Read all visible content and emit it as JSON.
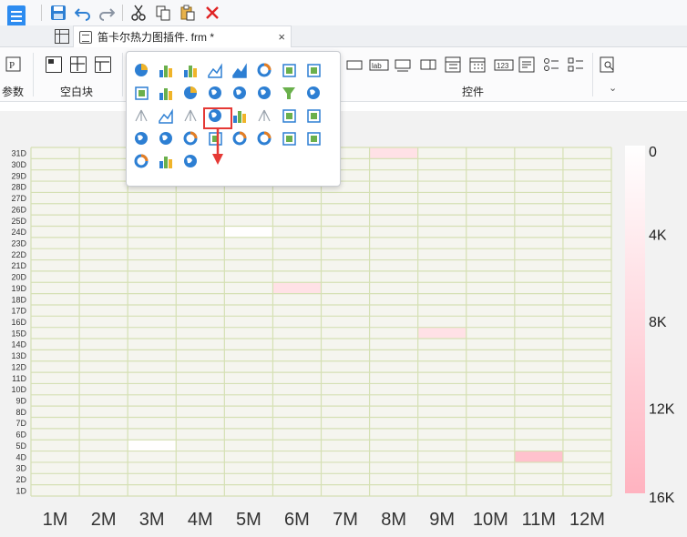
{
  "toolbar": {
    "save_icon": "save-icon",
    "undo_icon": "undo-icon",
    "redo_icon": "redo-icon",
    "cut_icon": "cut-icon",
    "copy_icon": "copy-icon",
    "paste_icon": "paste-icon",
    "delete_icon": "delete-icon"
  },
  "tab": {
    "title": "笛卡尔热力图插件. frm *",
    "close": "×"
  },
  "ribbon": {
    "param_label": "参数",
    "blank_block_label": "空白块",
    "controls_label": "控件",
    "expand_icon": "chevron-down-icon"
  },
  "heatmap": {
    "colors": {
      "grid_line": "#d5e0b4",
      "cell_fill": "#f5f5ef",
      "scale_top": "#ffffff",
      "scale_bottom": "#ffb3c0",
      "cell_highlight": "#ffd4dc"
    },
    "legend_ticks": [
      "0",
      "4K",
      "8K",
      "12K",
      "16K"
    ]
  },
  "chart_data": {
    "type": "heatmap",
    "x_categories": [
      "1M",
      "2M",
      "3M",
      "4M",
      "5M",
      "6M",
      "7M",
      "8M",
      "9M",
      "10M",
      "11M",
      "12M"
    ],
    "y_categories": [
      "1D",
      "2D",
      "3D",
      "4D",
      "5D",
      "6D",
      "7D",
      "8D",
      "9D",
      "10D",
      "11D",
      "12D",
      "13D",
      "14D",
      "15D",
      "16D",
      "17D",
      "18D",
      "19D",
      "20D",
      "21D",
      "22D",
      "23D",
      "24D",
      "25D",
      "26D",
      "27D",
      "28D",
      "29D",
      "30D",
      "31D"
    ],
    "legend_range": [
      0,
      16000
    ],
    "points": [
      {
        "x": "8M",
        "y": "31D",
        "value": 4000
      },
      {
        "x": "5M",
        "y": "24D",
        "value": 100
      },
      {
        "x": "6M",
        "y": "19D",
        "value": 4000
      },
      {
        "x": "9M",
        "y": "15D",
        "value": 4000
      },
      {
        "x": "3M",
        "y": "5D",
        "value": 100
      },
      {
        "x": "11M",
        "y": "4D",
        "value": 8000
      }
    ]
  }
}
